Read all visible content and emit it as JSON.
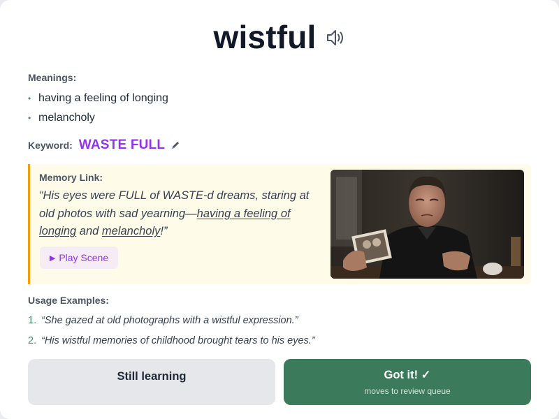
{
  "word": "wistful",
  "icons": {
    "pronounce": "speaker-icon",
    "edit": "pencil-icon",
    "play": "play-icon"
  },
  "meanings": {
    "label": "Meanings:",
    "items": [
      "having a feeling of longing",
      "melancholy"
    ]
  },
  "keyword": {
    "label": "Keyword:",
    "value": "WASTE FULL"
  },
  "memory": {
    "label": "Memory Link:",
    "text_parts": [
      "“His eyes were FULL of WASTE-d dreams, staring at old photos with sad yearning—",
      "having a feeling of longing",
      " and ",
      "melancholy",
      "!”"
    ],
    "play_label": "Play Scene",
    "image_alt": "Man looking wistfully at an old photograph"
  },
  "usage": {
    "label": "Usage Examples:",
    "items": [
      {
        "num": "1.",
        "text": "“She gazed at old photographs with a wistful expression.”"
      },
      {
        "num": "2.",
        "text": "“His wistful memories of childhood brought tears to his eyes.”"
      }
    ]
  },
  "actions": {
    "still_learning": "Still learning",
    "got_it": "Got it! ✓",
    "got_it_sub": "moves to review queue"
  },
  "colors": {
    "accent_purple": "#9333ea",
    "accent_green": "#3b7a5a",
    "memory_bg": "#fefbe8",
    "memory_border": "#f59e0b"
  }
}
